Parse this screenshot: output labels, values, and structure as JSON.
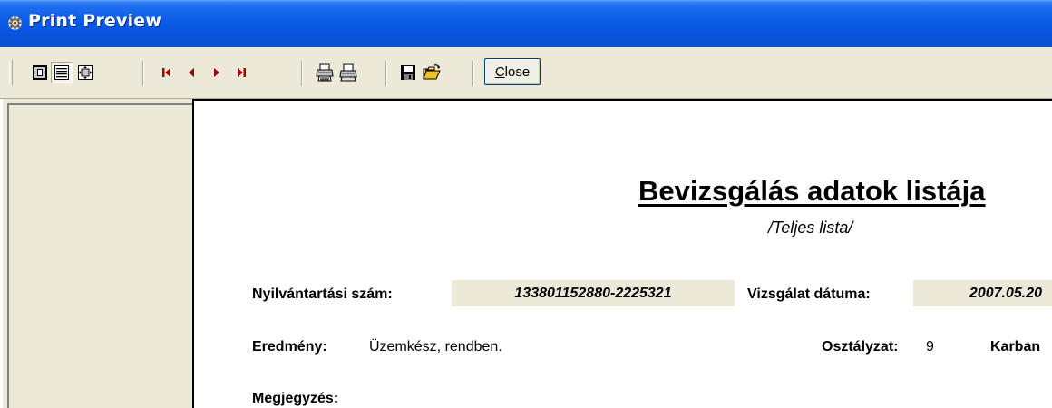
{
  "window": {
    "title": "Print Preview"
  },
  "toolbar": {
    "close_label_underlined": "C",
    "close_label_rest": "lose",
    "icons": [
      "one-page-icon",
      "two-page-icon",
      "zoom-fit-icon",
      "first-page-icon",
      "prev-page-icon",
      "next-page-icon",
      "last-page-icon",
      "print-setup-icon",
      "print-icon",
      "save-icon",
      "open-icon"
    ]
  },
  "report": {
    "title": "Bevizsgálás adatok listája",
    "subtitle": "/Teljes lista/",
    "reg_label": "Nyilvántartási szám:",
    "reg_value": "133801152880-2225321",
    "date_label": "Vizsgálat dátuma:",
    "date_value": "2007.05.20",
    "result_label": "Eredmény:",
    "result_value": "Üzemkész, rendben.",
    "class_label": "Osztályzat:",
    "class_value": "9",
    "karban_label": "Karban",
    "note_label": "Megjegyzés:"
  }
}
